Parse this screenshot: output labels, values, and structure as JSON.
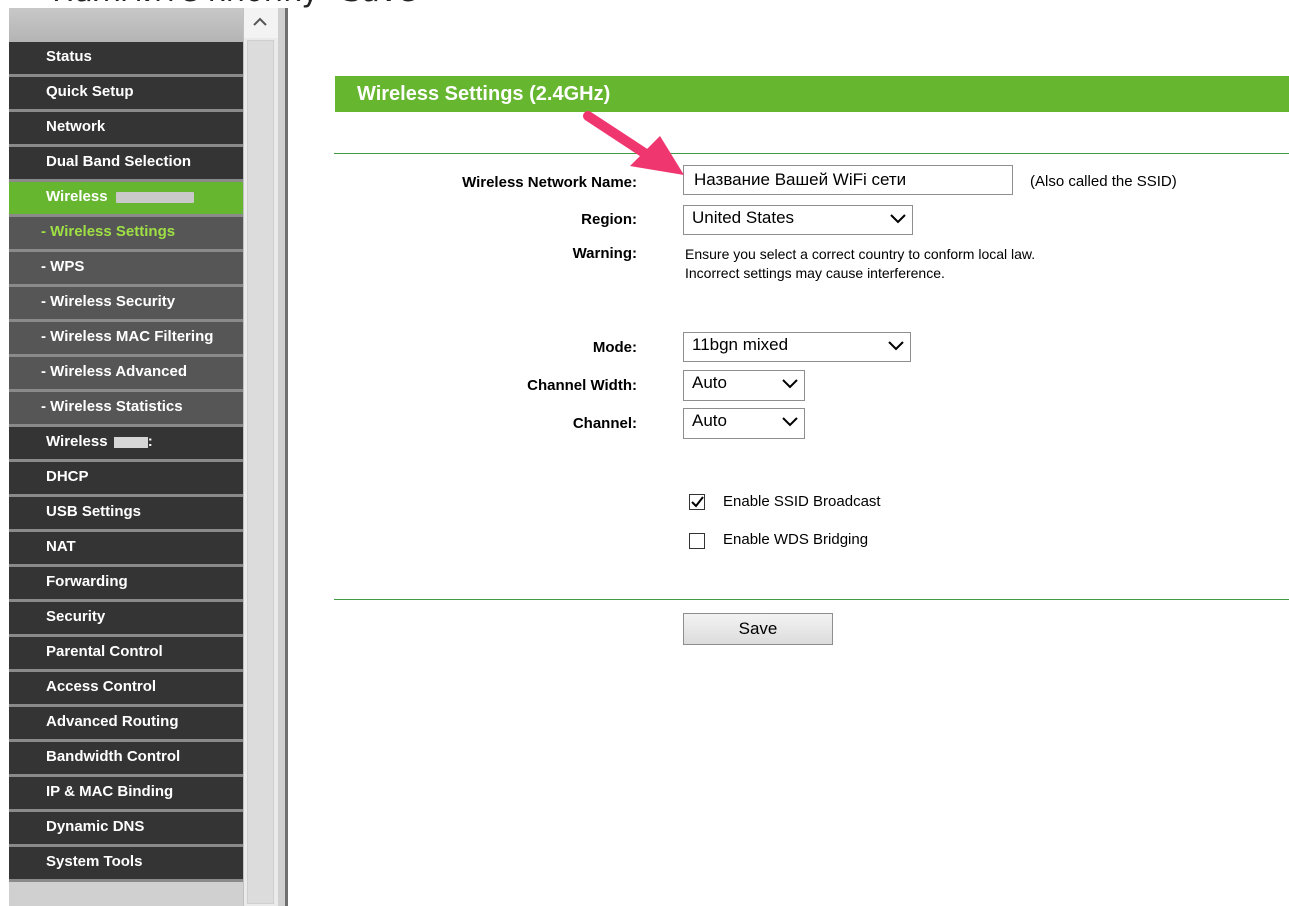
{
  "caption": {
    "text": "Нажмите кнопку \"Save\""
  },
  "sidebar": {
    "items": [
      {
        "label": "Status",
        "type": "main"
      },
      {
        "label": "Quick Setup",
        "type": "main"
      },
      {
        "label": "Network",
        "type": "main"
      },
      {
        "label": "Dual Band Selection",
        "type": "main"
      },
      {
        "label": "Wireless ",
        "type": "main",
        "active": true
      },
      {
        "label": "- Wireless Settings",
        "type": "sub",
        "active": true
      },
      {
        "label": "- WPS",
        "type": "sub"
      },
      {
        "label": "- Wireless Security",
        "type": "sub"
      },
      {
        "label": "- Wireless MAC Filtering",
        "type": "sub"
      },
      {
        "label": "- Wireless Advanced",
        "type": "sub"
      },
      {
        "label": "- Wireless Statistics",
        "type": "sub"
      },
      {
        "label": "Wireless ",
        "type": "main"
      },
      {
        "label": "DHCP",
        "type": "main"
      },
      {
        "label": "USB Settings",
        "type": "main"
      },
      {
        "label": "NAT",
        "type": "main"
      },
      {
        "label": "Forwarding",
        "type": "main"
      },
      {
        "label": "Security",
        "type": "main"
      },
      {
        "label": "Parental Control",
        "type": "main"
      },
      {
        "label": "Access Control",
        "type": "main"
      },
      {
        "label": "Advanced Routing",
        "type": "main"
      },
      {
        "label": "Bandwidth Control",
        "type": "main"
      },
      {
        "label": "IP & MAC Binding",
        "type": "main"
      },
      {
        "label": "Dynamic DNS",
        "type": "main"
      },
      {
        "label": "System Tools",
        "type": "main"
      }
    ]
  },
  "page": {
    "title": "Wireless Settings (2.4GHz)",
    "ssid_label": "Wireless Network Name:",
    "ssid_value": "Название Вашей WiFi сети",
    "ssid_hint": "(Also called the SSID)",
    "region_label": "Region:",
    "region_value": "United States",
    "warning_label": "Warning:",
    "warning_line1": "Ensure you select a correct country to conform local law.",
    "warning_line2": "Incorrect settings may cause interference.",
    "mode_label": "Mode:",
    "mode_value": "11bgn mixed",
    "channel_width_label": "Channel Width:",
    "channel_width_value": "Auto",
    "channel_label": "Channel:",
    "channel_value": "Auto",
    "ssid_broadcast_label": "Enable SSID Broadcast",
    "ssid_broadcast_checked": true,
    "wds_label": "Enable WDS Bridging",
    "wds_checked": false,
    "save_label": "Save"
  },
  "colors": {
    "accent_green": "#66b630",
    "menu_dark": "#343434",
    "menu_sub": "#565656",
    "arrow_pink": "#f0366e"
  }
}
